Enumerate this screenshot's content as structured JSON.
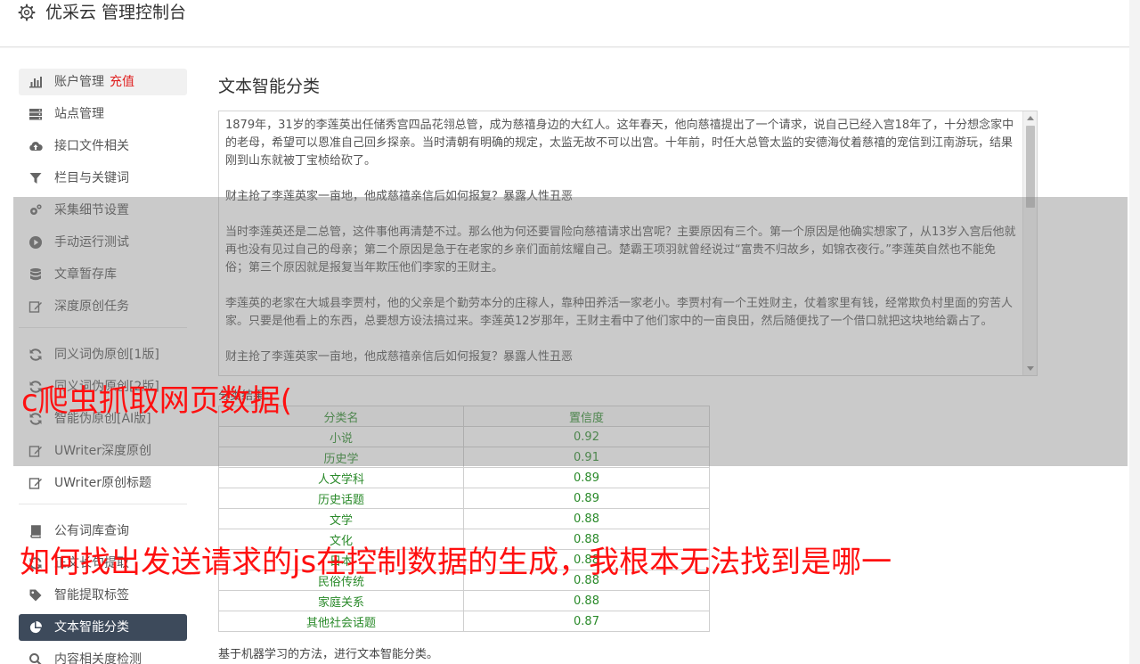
{
  "header": {
    "title": "优采云 管理控制台"
  },
  "sidebar": {
    "items": [
      {
        "label": "账户管理",
        "extra": "充值",
        "icon": "bar-chart-icon"
      },
      {
        "label": "站点管理",
        "icon": "server-icon"
      },
      {
        "label": "接口文件相关",
        "icon": "cloud-upload-icon"
      },
      {
        "label": "栏目与关键词",
        "icon": "filter-icon"
      },
      {
        "label": "采集细节设置",
        "icon": "cogs-icon"
      },
      {
        "label": "手动运行测试",
        "icon": "play-circle-icon"
      },
      {
        "label": "文章暂存库",
        "icon": "database-icon"
      },
      {
        "label": "深度原创任务",
        "icon": "edit-icon"
      },
      {
        "label": "同义词伪原创[1版]",
        "icon": "refresh-icon"
      },
      {
        "label": "同义词伪原创[2版]",
        "icon": "refresh-icon"
      },
      {
        "label": "智能伪原创[AI版]",
        "icon": "refresh-icon"
      },
      {
        "label": "UWriter深度原创",
        "icon": "edit-icon"
      },
      {
        "label": "UWriter原创标题",
        "icon": "edit-icon"
      },
      {
        "label": "公有词库查询",
        "icon": "book-icon"
      },
      {
        "label": "正文长句提取",
        "icon": "refresh-icon"
      },
      {
        "label": "智能提取标签",
        "icon": "tag-icon"
      },
      {
        "label": "文本智能分类",
        "icon": "pie-chart-icon"
      },
      {
        "label": "内容相关度检测",
        "icon": "search-icon"
      }
    ]
  },
  "content": {
    "title": "文本智能分类",
    "paragraphs": [
      "1879年，31岁的李莲英出任储秀宫四品花翎总管，成为慈禧身边的大红人。这年春天，他向慈禧提出了一个请求，说自己已经入宫18年了，十分想念家中的老母，希望可以恩准自己回乡探亲。当时清朝有明确的规定，太监无故不可以出宫。十年前，时任大总管太监的安德海仗着慈禧的宠信到江南游玩，结果刚到山东就被丁宝桢给砍了。",
      "财主抢了李莲英家一亩地，他成慈禧亲信后如何报复？暴露人性丑恶",
      "当时李莲英还是二总管，这件事他再清楚不过。那么他为何还要冒险向慈禧请求出宫呢？主要原因有三个。第一个原因是他确实想家了，从13岁入宫后他就再也没有见过自己的母亲；第二个原因是急于在老家的乡亲们面前炫耀自己。楚霸王项羽就曾经说过“富贵不归故乡，如锦衣夜行。”李莲英自然也不能免俗；第三个原因就是报复当年欺压他们李家的王财主。",
      "李莲英的老家在大城县李贾村，他的父亲是个勤劳本分的庄稼人，靠种田养活一家老小。李贾村有一个王姓财主，仗着家里有钱，经常欺负村里面的穷苦人家。只要是他看上的东西，总要想方设法搞过来。李莲英12岁那年，王财主看中了他们家中的一亩良田，然后随便找了一个借口就把这块地给霸占了。",
      "财主抢了李莲英家一亩地，他成慈禧亲信后如何报复？暴露人性丑恶"
    ],
    "result_label": "分类结果：",
    "table": {
      "headers": [
        "分类名",
        "置信度"
      ],
      "rows": [
        [
          "小说",
          "0.92"
        ],
        [
          "历史学",
          "0.91"
        ],
        [
          "人文学科",
          "0.89"
        ],
        [
          "历史话题",
          "0.89"
        ],
        [
          "文学",
          "0.88"
        ],
        [
          "文化",
          "0.88"
        ],
        [
          "日本",
          "0.88"
        ],
        [
          "民俗传统",
          "0.88"
        ],
        [
          "家庭关系",
          "0.88"
        ],
        [
          "其他社会话题",
          "0.87"
        ]
      ]
    },
    "footer_note": "基于机器学习的方法，进行文本智能分类。"
  },
  "overlay": {
    "line1": "c爬虫抓取网页数据(",
    "line2": "如何找出发送请求的js在控制数据的生成，我根本无法找到是哪一"
  },
  "colors": {
    "active_nav": "#3d4a5b",
    "result_text": "#2a8a2a",
    "overlay_text": "#ff1010",
    "recharge": "#e02020"
  }
}
